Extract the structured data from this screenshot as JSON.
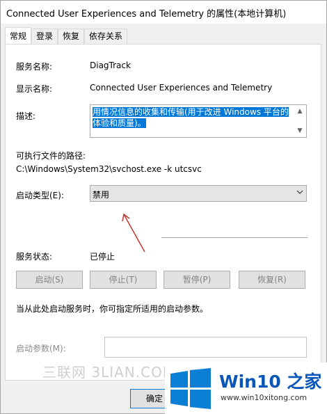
{
  "window": {
    "title": "Connected User Experiences and Telemetry 的属性(本地计算机)"
  },
  "tabs": [
    {
      "label": "常规"
    },
    {
      "label": "登录"
    },
    {
      "label": "恢复"
    },
    {
      "label": "依存关系"
    }
  ],
  "general": {
    "service_name_label": "服务名称:",
    "service_name_value": "DiagTrack",
    "display_name_label": "显示名称:",
    "display_name_value": "Connected User Experiences and Telemetry",
    "description_label": "描述:",
    "description_value": "用情况信息的收集和传输(用于改进 Windows 平台的体验和质量)。",
    "exec_path_label": "可执行文件的路径:",
    "exec_path_value": "C:\\Windows\\System32\\svchost.exe -k utcsvc",
    "startup_type_label": "启动类型(E):",
    "startup_type_value": "禁用",
    "service_status_label": "服务状态:",
    "service_status_value": "已停止",
    "buttons": {
      "start": "启动(S)",
      "stop": "停止(T)",
      "pause": "暂停(P)",
      "resume": "恢复(R)"
    },
    "hint": "当从此处启动服务时，你可指定所适用的启动参数。",
    "start_params_label": "启动参数(M):",
    "start_params_value": ""
  },
  "footer": {
    "ok_label": "确定"
  },
  "watermarks": {
    "left": "三联网 3LIAN.COM",
    "logo_main": "Win10 之家",
    "logo_sub": "www.win10xitong.com"
  },
  "colors": {
    "selection": "#0078d7",
    "logo_blue": "#0a56b8",
    "annotation_arrow": "#c0392b"
  },
  "icons": {
    "dropdown": "chevron-down-icon",
    "logo": "windows-logo-icon"
  }
}
